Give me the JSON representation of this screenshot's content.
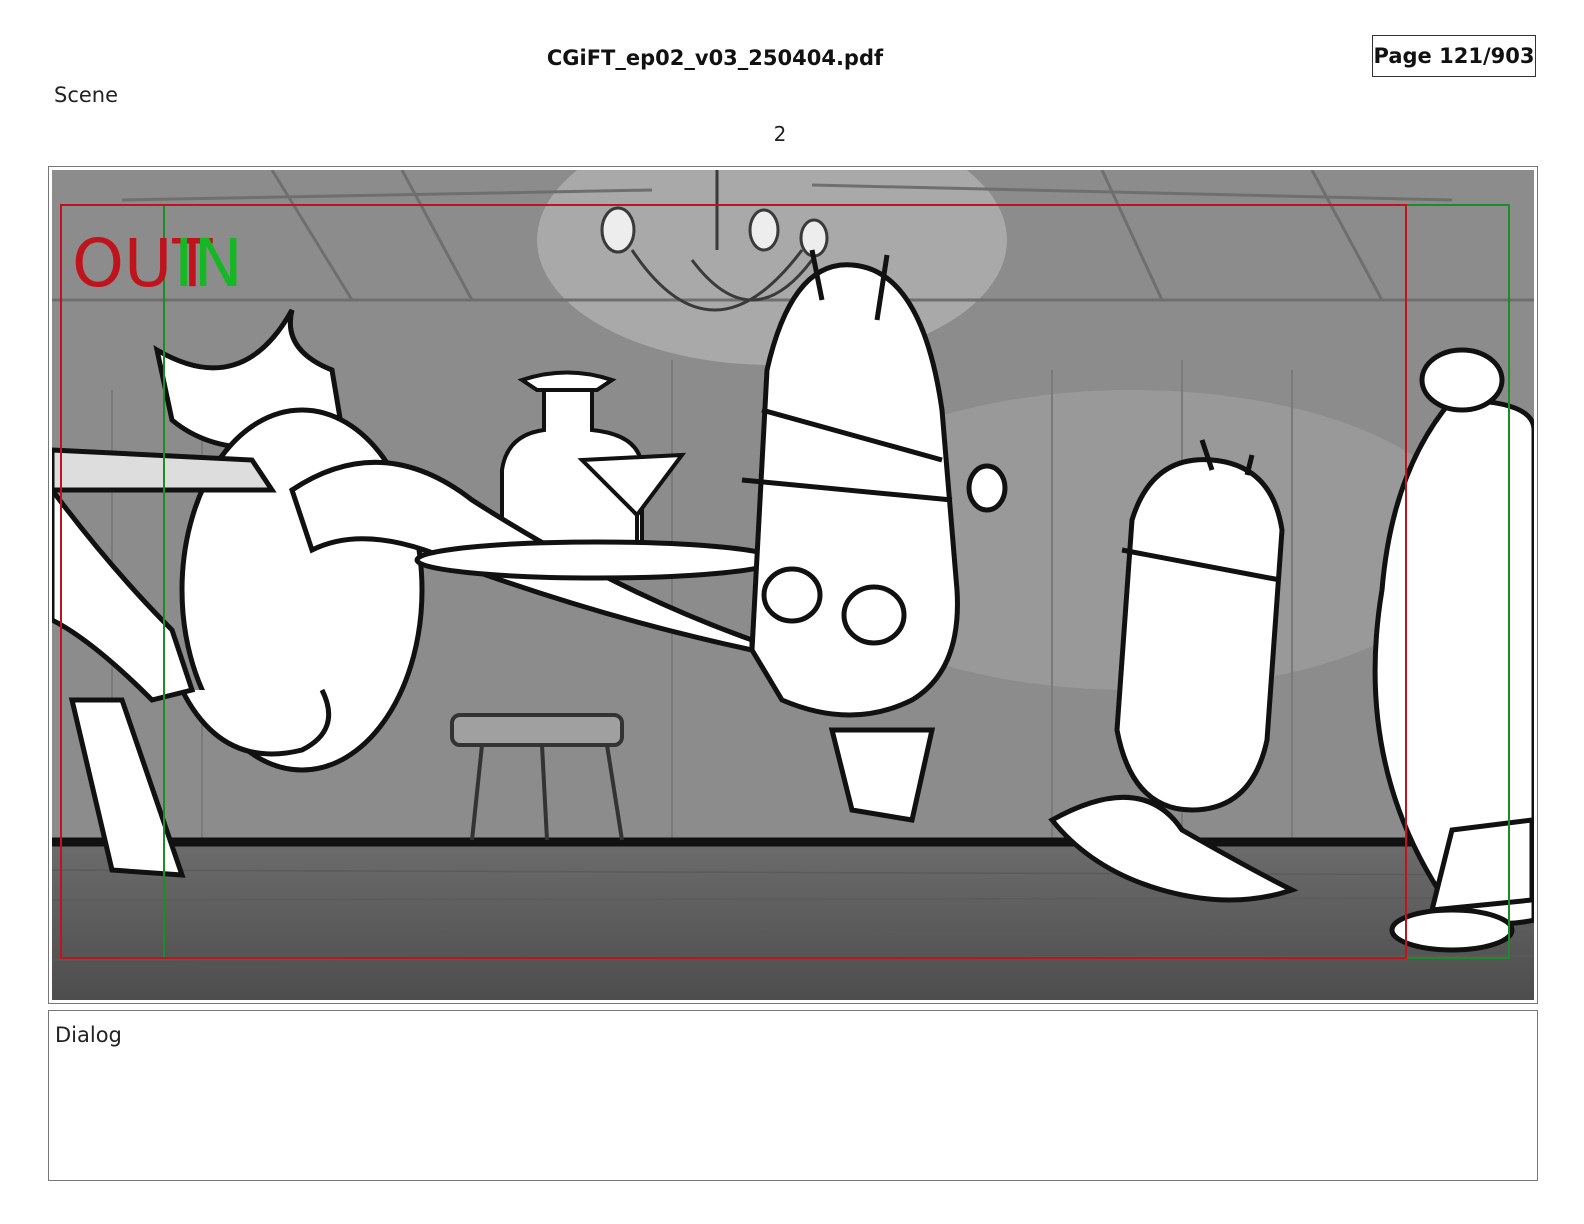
{
  "header": {
    "file_name": "CGiFT_ep02_v03_250404.pdf",
    "page_indicator": "Page 121/903"
  },
  "scene": {
    "label": "Scene",
    "number": "2"
  },
  "panel": {
    "out_marker": "OUT",
    "in_marker": "IN",
    "colors": {
      "out_frame": "#c0141c",
      "in_frame": "#1f8a2a",
      "out_text": "#c0141c",
      "in_text": "#14b823"
    }
  },
  "dialog": {
    "label": "Dialog"
  }
}
